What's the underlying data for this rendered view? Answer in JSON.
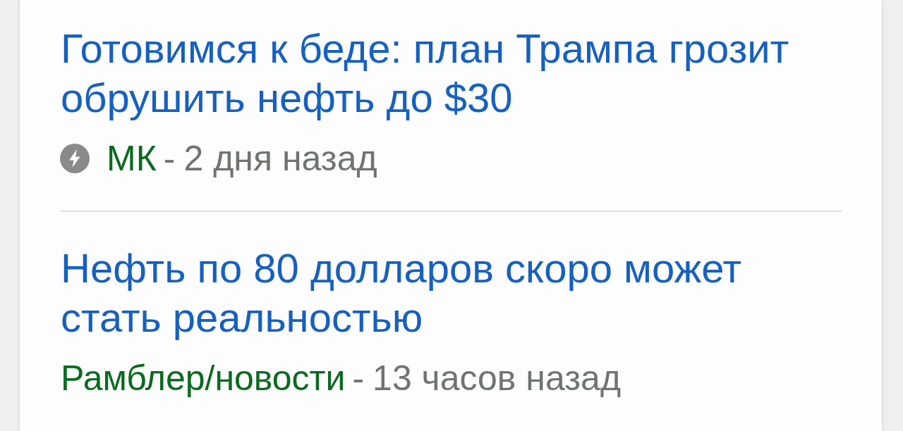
{
  "articles": [
    {
      "headline": "Готовимся к беде: план Трампа грозит обрушить нефть до $30",
      "amp": true,
      "source": "МК",
      "separator": "-",
      "time": "2 дня назад"
    },
    {
      "headline": "Нефть по 80 долларов скоро может стать реальностью",
      "amp": false,
      "source": "Рамблер/новости",
      "separator": "-",
      "time": "13 часов назад"
    }
  ]
}
